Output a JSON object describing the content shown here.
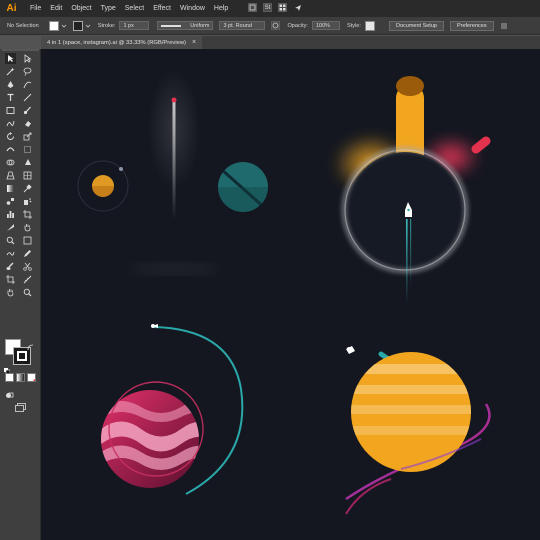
{
  "app": {
    "logo": "Ai"
  },
  "menu": [
    "File",
    "Edit",
    "Object",
    "Type",
    "Select",
    "Effect",
    "Window",
    "Help"
  ],
  "menubar_icons": [
    "bridge-icon",
    "stock-icon",
    "arrange-documents-icon",
    "send-icon"
  ],
  "menubar_icon_glyphs": {
    "stock": "St"
  },
  "control_bar": {
    "selection_label": "No Selection",
    "stroke_label": "Stroke:",
    "stroke_value": "1 px",
    "profile_value": "Uniform",
    "brush_value": "3 pt. Round",
    "opacity_label": "Opacity:",
    "opacity_value": "100%",
    "style_label": "Style:",
    "document_setup": "Document Setup",
    "preferences": "Preferences"
  },
  "document_tab": {
    "title": "4 in 1 (space, instagram).ai @ 33.33% (RGB/Preview)",
    "close": "×"
  },
  "colors": {
    "canvas": "#141720",
    "orange": "#f2a51f",
    "teal": "#1c6b6e",
    "pink": "#d6285e",
    "accent_stroke": "#2aa7a8"
  }
}
